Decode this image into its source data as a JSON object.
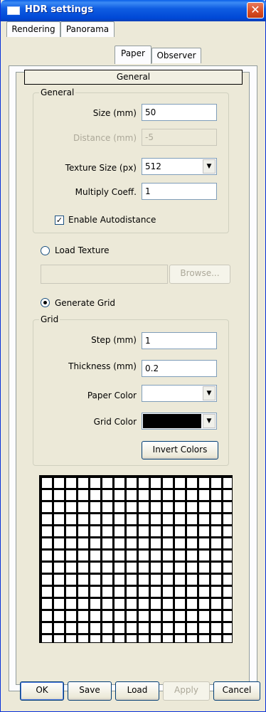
{
  "window": {
    "title": "HDR settings"
  },
  "tabs": [
    {
      "label": "Rendering",
      "active": false
    },
    {
      "label": "Panorama",
      "active": false
    },
    {
      "label": "Paper",
      "active": true
    },
    {
      "label": "Observer",
      "active": false
    }
  ],
  "page_header": "General",
  "general_group": {
    "title": "General",
    "size_label": "Size (mm)",
    "size_value": "50",
    "distance_label": "Distance (mm)",
    "distance_value": "-5",
    "texture_size_label": "Texture Size (px)",
    "texture_size_value": "512",
    "multiply_label": "Multiply Coeff.",
    "multiply_value": "1",
    "autodistance_label": "Enable Autodistance",
    "autodistance_checked": true
  },
  "load_texture": {
    "label": "Load Texture",
    "selected": false,
    "path_value": "",
    "browse_label": "Browse..."
  },
  "generate_grid": {
    "label": "Generate Grid",
    "selected": true
  },
  "grid_group": {
    "title": "Grid",
    "step_label": "Step (mm)",
    "step_value": "1",
    "thickness_label": "Thickness (mm)",
    "thickness_value": "0.2",
    "paper_color_label": "Paper Color",
    "paper_color": "#ffffff",
    "grid_color_label": "Grid Color",
    "grid_color": "#000000",
    "invert_label": "Invert Colors"
  },
  "footer": {
    "ok": "OK",
    "save": "Save",
    "load": "Load",
    "apply": "Apply",
    "cancel": "Cancel"
  },
  "colors": {
    "title_bar": "#0a5fe8",
    "close": "#d84b22",
    "window_bg": "#ece9d8"
  }
}
